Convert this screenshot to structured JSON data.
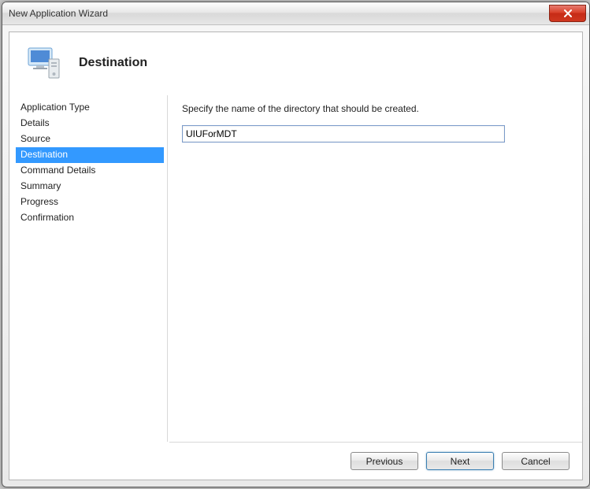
{
  "window": {
    "title": "New Application Wizard"
  },
  "page": {
    "heading": "Destination"
  },
  "sidebar": {
    "items": [
      {
        "label": "Application Type"
      },
      {
        "label": "Details"
      },
      {
        "label": "Source"
      },
      {
        "label": "Destination",
        "selected": true
      },
      {
        "label": "Command Details"
      },
      {
        "label": "Summary"
      },
      {
        "label": "Progress"
      },
      {
        "label": "Confirmation"
      }
    ]
  },
  "content": {
    "instruction": "Specify the name of the directory that should be created.",
    "directory_value": "UIUForMDT"
  },
  "buttons": {
    "previous": "Previous",
    "next": "Next",
    "cancel": "Cancel"
  }
}
